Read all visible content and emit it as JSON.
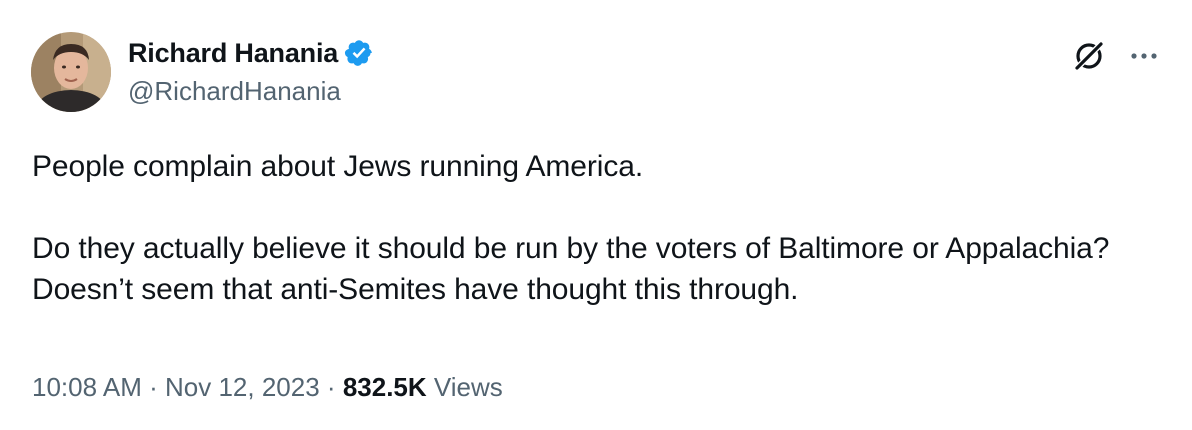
{
  "author": {
    "display_name": "Richard Hanania",
    "handle": "@RichardHanania",
    "verified": true
  },
  "tweet": {
    "paragraphs": [
      "People complain about Jews running America.",
      "Do they actually believe it should be run by the voters of Baltimore or Appalachia? Doesn’t seem that anti-Semites have thought this through."
    ]
  },
  "meta": {
    "time": "10:08 AM",
    "separator": "·",
    "date": "Nov 12, 2023",
    "views_count": "832.5K",
    "views_label": "Views"
  },
  "icons": {
    "verified": "verified-badge-icon",
    "grok": "grok-icon",
    "more": "more-options-icon"
  },
  "colors": {
    "text_primary": "#0f1419",
    "text_secondary": "#536471",
    "verified_blue": "#1d9bf0"
  }
}
